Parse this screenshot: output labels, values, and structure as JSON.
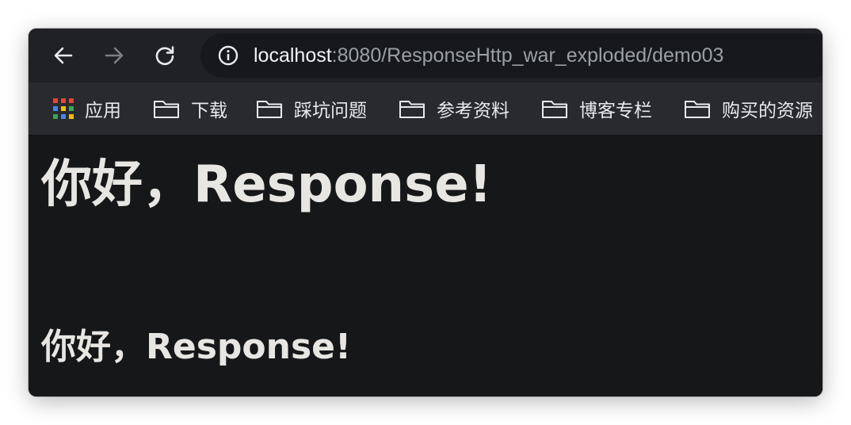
{
  "browser": {
    "nav": {
      "back_icon": "arrow-left-icon",
      "forward_icon": "arrow-right-icon",
      "reload_icon": "reload-icon"
    },
    "address_bar": {
      "icon": "info-icon",
      "host": "localhost",
      "rest": ":8080/ResponseHttp_war_exploded/demo03"
    },
    "bookmarks": {
      "items": [
        {
          "label": "应用",
          "icon": "apps-grid-icon"
        },
        {
          "label": "下载",
          "icon": "folder-icon"
        },
        {
          "label": "踩坑问题",
          "icon": "folder-icon"
        },
        {
          "label": "参考资料",
          "icon": "folder-icon"
        },
        {
          "label": "博客专栏",
          "icon": "folder-icon"
        },
        {
          "label": "购买的资源",
          "icon": "folder-icon"
        }
      ]
    },
    "colors": {
      "toolbar_bg": "#202124",
      "bookmarks_bg": "#292a2d",
      "page_bg": "#161719",
      "text": "#e8e6e3"
    }
  },
  "page": {
    "heading1": "你好，Response!",
    "heading2": "你好，Response!"
  }
}
